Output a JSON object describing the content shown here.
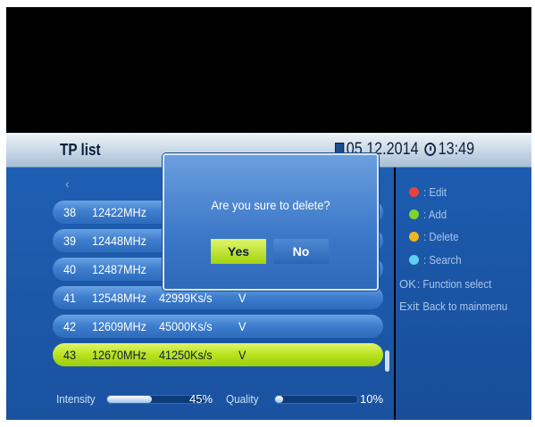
{
  "header": {
    "title": "TP list",
    "date": "05 12.2014",
    "time": "13:49"
  },
  "nav": {
    "left": "‹",
    "right": "›"
  },
  "transponders": [
    {
      "num": "38",
      "freq": "12422MHz",
      "sr": "",
      "pol": "",
      "selected": false
    },
    {
      "num": "39",
      "freq": "12448MHz",
      "sr": "",
      "pol": "",
      "selected": false
    },
    {
      "num": "40",
      "freq": "12487MHz",
      "sr": "",
      "pol": "",
      "selected": false
    },
    {
      "num": "41",
      "freq": "12548MHz",
      "sr": "42999Ks/s",
      "pol": "V",
      "selected": false
    },
    {
      "num": "42",
      "freq": "12609MHz",
      "sr": "45000Ks/s",
      "pol": "V",
      "selected": false
    },
    {
      "num": "43",
      "freq": "12670MHz",
      "sr": "41250Ks/s",
      "pol": "V",
      "selected": true
    }
  ],
  "signal": {
    "intensity_label": "Intensity",
    "intensity_value": "45%",
    "intensity": 0.45,
    "quality_label": "Quality",
    "quality_value": "10%",
    "quality": 0.1
  },
  "legend": {
    "edit": {
      "label": ": Edit",
      "color": "#e8433a"
    },
    "add": {
      "label": ": Add",
      "color": "#7fd32a"
    },
    "delete": {
      "label": ": Delete",
      "color": "#f0b81e"
    },
    "search": {
      "label": ": Search",
      "color": "#5fd0f0"
    },
    "ok_key": "OK",
    "ok_label": ": Function select",
    "exit_key": "Exit",
    "exit_label": ": Back to mainmenu"
  },
  "dialog": {
    "message": "Are you sure to delete?",
    "yes": "Yes",
    "no": "No"
  }
}
